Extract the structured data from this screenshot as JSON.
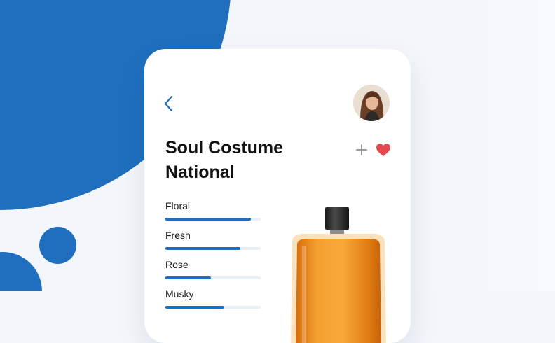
{
  "product": {
    "title_line1": "Soul Costume",
    "title_line2": "National"
  },
  "icons": {
    "back": "chevron-left-icon",
    "add": "plus-icon",
    "favorite": "heart-icon"
  },
  "notes": [
    {
      "label": "Floral",
      "level": 0.9
    },
    {
      "label": "Fresh",
      "level": 0.79
    },
    {
      "label": "Rose",
      "level": 0.48
    },
    {
      "label": "Musky",
      "level": 0.62
    }
  ],
  "colors": {
    "accent": "#1f6fbe",
    "heart": "#e5484d",
    "bottle_liquid": "#f0921b"
  }
}
